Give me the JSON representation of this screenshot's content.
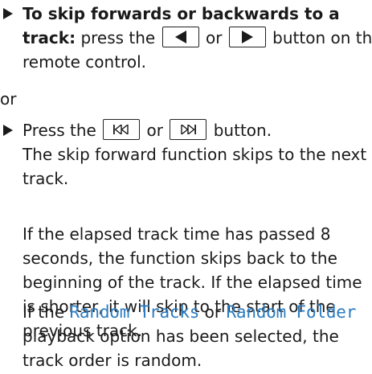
{
  "step1": {
    "lead_bold": "To skip forwards or backwards to a track:",
    "text_before": "press the",
    "text_or": "or",
    "text_after": "button on the remote control."
  },
  "or_text": "or",
  "step2": {
    "text_before": "Press the",
    "text_or": "or",
    "text_after": "button."
  },
  "para_skip_forward": "The skip forward function skips to the next track.",
  "para_elapsed": "If the elapsed track time has passed 8 seconds, the function skips back to the beginning of the track. If the elapsed time is shorter, it will skip to the start of the previous track.",
  "random": {
    "prefix": "If the",
    "option1": "Random Tracks",
    "middle": "or",
    "option2": "Random Folder",
    "suffix": "playback option has been selected, the track order is random."
  },
  "colors": {
    "accent": "#2b7cc1",
    "text": "#1a1a1a"
  },
  "icons": [
    "arrow-left-icon",
    "arrow-right-icon",
    "skip-back-icon",
    "skip-forward-icon",
    "bullet-triangle-icon"
  ]
}
